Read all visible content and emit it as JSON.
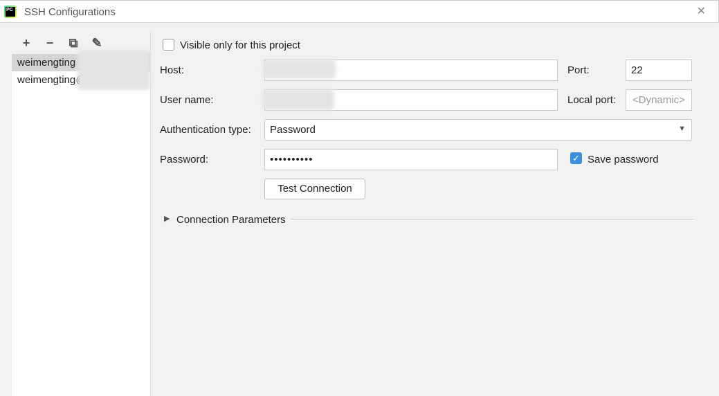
{
  "window": {
    "title": "SSH Configurations",
    "logo_text": "PC"
  },
  "toolbar": {
    "add": "+",
    "remove": "−",
    "copy": "⧉",
    "edit": "✎"
  },
  "configs": [
    {
      "label": "weimengting"
    },
    {
      "label": "weimengting@2"
    }
  ],
  "form": {
    "visible_only_label": "Visible only for this project",
    "visible_only_checked": false,
    "host_label": "Host:",
    "host_value": "",
    "port_label": "Port:",
    "port_value": "22",
    "user_label": "User name:",
    "user_value": "",
    "local_port_label": "Local port:",
    "local_port_placeholder": "<Dynamic>",
    "auth_label": "Authentication type:",
    "auth_value": "Password",
    "password_label": "Password:",
    "password_value": "••••••••••",
    "save_password_label": "Save password",
    "save_password_checked": true,
    "test_button": "Test Connection",
    "conn_params": "Connection Parameters"
  },
  "colors": {
    "accent": "#3c8fdc"
  }
}
